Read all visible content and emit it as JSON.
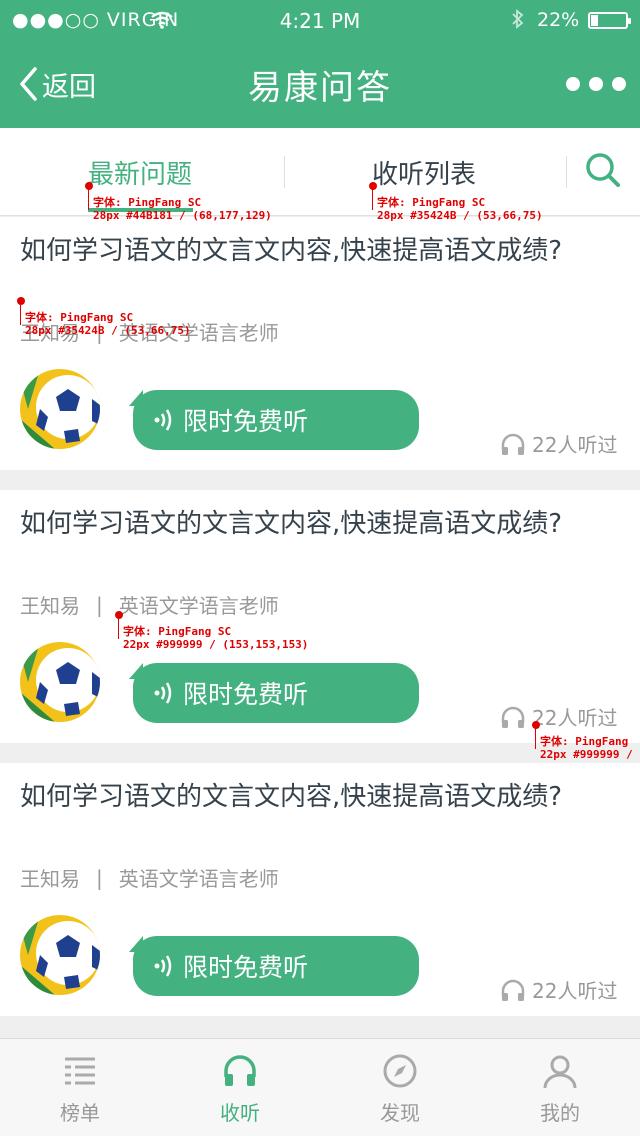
{
  "status_bar": {
    "carrier": "●●●○○ VIRGIN",
    "time": "4:21 PM",
    "battery": "22%",
    "battery_level": 0.22
  },
  "nav": {
    "back_label": "返回",
    "title": "易康问答"
  },
  "tabs": {
    "newest": "最新问题",
    "listen_list": "收听列表"
  },
  "cards": [
    {
      "question": "如何学习语文的文言文内容,快速提高语文成绩?",
      "author": "王知易",
      "author_title": "英语文学语言老师",
      "play_label": "限时免费听",
      "listeners": "22人听过"
    },
    {
      "question": "如何学习语文的文言文内容,快速提高语文成绩?",
      "author": "王知易",
      "author_title": "英语文学语言老师",
      "play_label": "限时免费听",
      "listeners": "22人听过"
    },
    {
      "question": "如何学习语文的文言文内容,快速提高语文成绩?",
      "author": "王知易",
      "author_title": "英语文学语言老师",
      "play_label": "限时免费听",
      "listeners": "22人听过"
    }
  ],
  "annotations": {
    "a1_font": "字体: PingFang SC",
    "a1_spec": "28px #44B181 / (68,177,129)",
    "a2_font": "字体: PingFang SC",
    "a2_spec": "28px #35424B / (53,66,75)",
    "a3_font": "字体: PingFang SC",
    "a3_spec": "28px #35424B / (53,66,75)",
    "a4_font": "字体: PingFang SC",
    "a4_spec": "22px #999999 / (153,153,153)",
    "a5_font": "字体: PingFang",
    "a5_spec": "22px #999999 /"
  },
  "tabbar": {
    "items": [
      {
        "label": "榜单",
        "icon": "list-icon"
      },
      {
        "label": "收听",
        "icon": "headphones-icon"
      },
      {
        "label": "发现",
        "icon": "compass-icon"
      },
      {
        "label": "我的",
        "icon": "user-icon"
      }
    ],
    "active_index": 1
  },
  "colors": {
    "accent": "#44B181",
    "text_dark": "#35424B",
    "text_gray": "#999999"
  }
}
